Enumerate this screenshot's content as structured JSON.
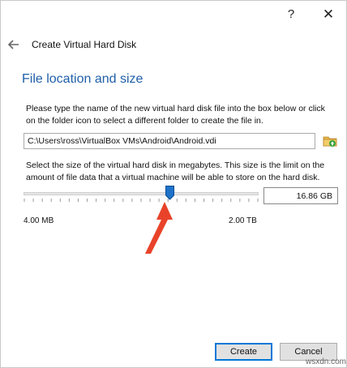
{
  "titlebar": {
    "help_label": "?",
    "close_label": "✕"
  },
  "header": {
    "title": "Create Virtual Hard Disk",
    "back_icon": "back-arrow-icon"
  },
  "section": {
    "title": "File location and size",
    "location_description": "Please type the name of the new virtual hard disk file into the box below or click on the folder icon to select a different folder to create the file in.",
    "path_value": "C:\\Users\\ross\\VirtualBox VMs\\Android\\Android.vdi",
    "folder_icon": "folder-icon",
    "size_description": "Select the size of the virtual hard disk in megabytes. This size is the limit on the amount of file data that a virtual machine will be able to store on the hard disk.",
    "size_value": "16.86 GB",
    "slider_min_label": "4.00 MB",
    "slider_max_label": "2.00 TB",
    "slider_position_fraction": 0.62,
    "slider_tick_count": 27
  },
  "annotation": {
    "arrow_color": "#e8432a"
  },
  "buttons": {
    "create_label": "Create",
    "cancel_label": "Cancel"
  },
  "watermark": "wsxdn.com",
  "colors": {
    "accent": "#1f5fa8",
    "thumb": "#1e73c9"
  }
}
